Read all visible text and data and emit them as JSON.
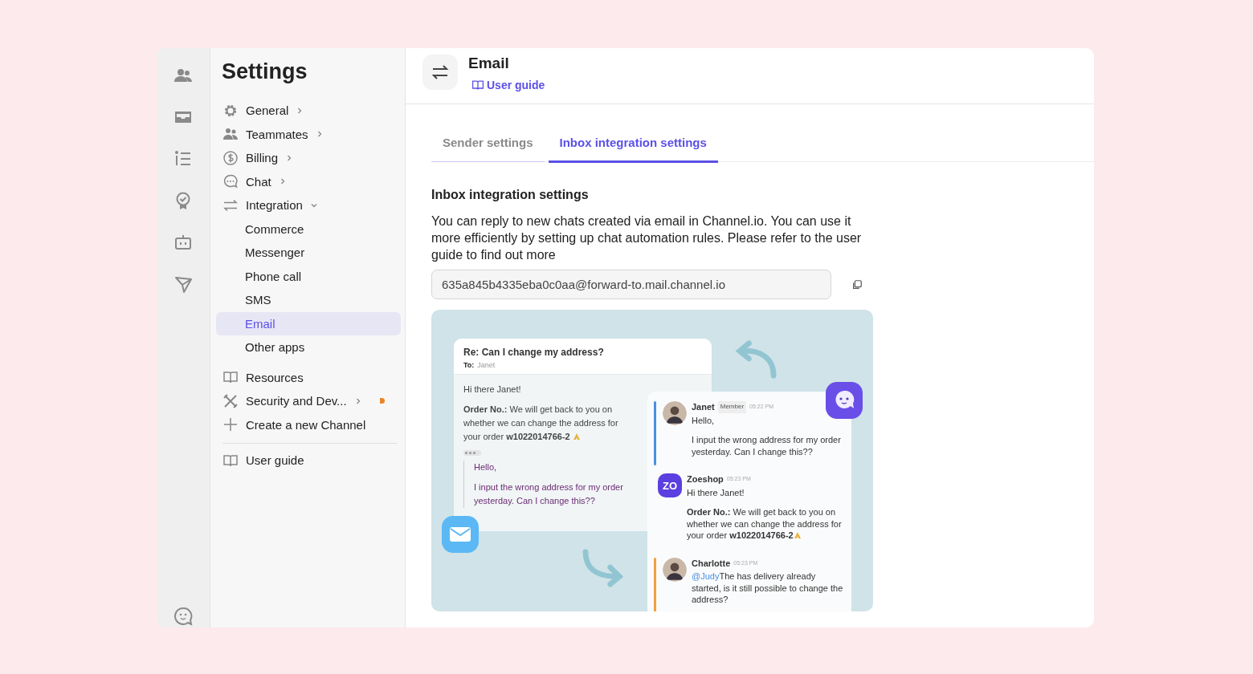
{
  "nav": {
    "title": "Settings",
    "sections": [
      [
        {
          "label": "General",
          "expanded": false
        },
        {
          "label": "Teammates",
          "expanded": false
        },
        {
          "label": "Billing",
          "expanded": false
        },
        {
          "label": "Chat",
          "expanded": false
        },
        {
          "label": "Integration",
          "expanded": true,
          "children": [
            {
              "label": "Commerce",
              "selected": false
            },
            {
              "label": "Messenger",
              "selected": false
            },
            {
              "label": "Phone call",
              "selected": false
            },
            {
              "label": "SMS",
              "selected": false
            },
            {
              "label": "Email",
              "selected": true
            },
            {
              "label": "Other apps",
              "selected": false
            }
          ]
        }
      ],
      [
        {
          "label": "Resources"
        },
        {
          "label": "Security and Dev...",
          "expanded": false,
          "alert": true
        },
        {
          "label": "Create a new Channel"
        }
      ],
      [
        {
          "label": "User guide"
        }
      ]
    ]
  },
  "header": {
    "title": "Email",
    "link": "User guide"
  },
  "tabs": [
    {
      "label": "Sender settings",
      "selected": false
    },
    {
      "label": "Inbox integration settings",
      "selected": true
    }
  ],
  "section": {
    "heading": "Inbox integration settings",
    "description": "You can reply to new chats created via email in Channel.io. You can use it more efficiently by setting up chat automation rules. Please refer to the user guide to find out more",
    "email_field": {
      "value": "635a845b4335eba0c0aa@forward-to.mail.channel.io"
    }
  },
  "illustration": {
    "email": {
      "subject": "Re: Can I change my address?",
      "to_label": "To:",
      "to": "Janet",
      "greeting": "Hi there Janet!",
      "body": "**Order No.:** We will get back to you on whether we can change the address for your order **w1022014766-2**",
      "quote": [
        "Hello,",
        "I input the wrong address for my order yesterday. Can I change this??"
      ]
    },
    "chat": [
      {
        "name": "Janet",
        "tag": "Member",
        "time": "05:22 PM",
        "kind": "photo",
        "color": "#4a90e2",
        "lines": [
          "Hello,",
          "I input the wrong address for my order yesterday. Can I change this??"
        ]
      },
      {
        "name": "Zoeshop",
        "time": "05:23 PM",
        "kind": "logo",
        "avatar_text": "ZO",
        "lines": [
          "Hi there Janet!",
          "**Order No.:** We will get back to you on whether we can change the address for your order **w1022014766-2**"
        ]
      },
      {
        "name": "Charlotte",
        "time": "05:23 PM",
        "kind": "photo",
        "color": "#f0a040",
        "mention": "@Judy",
        "lines": [
          "The has delivery already started, is it still possible to change the address?"
        ]
      }
    ]
  }
}
